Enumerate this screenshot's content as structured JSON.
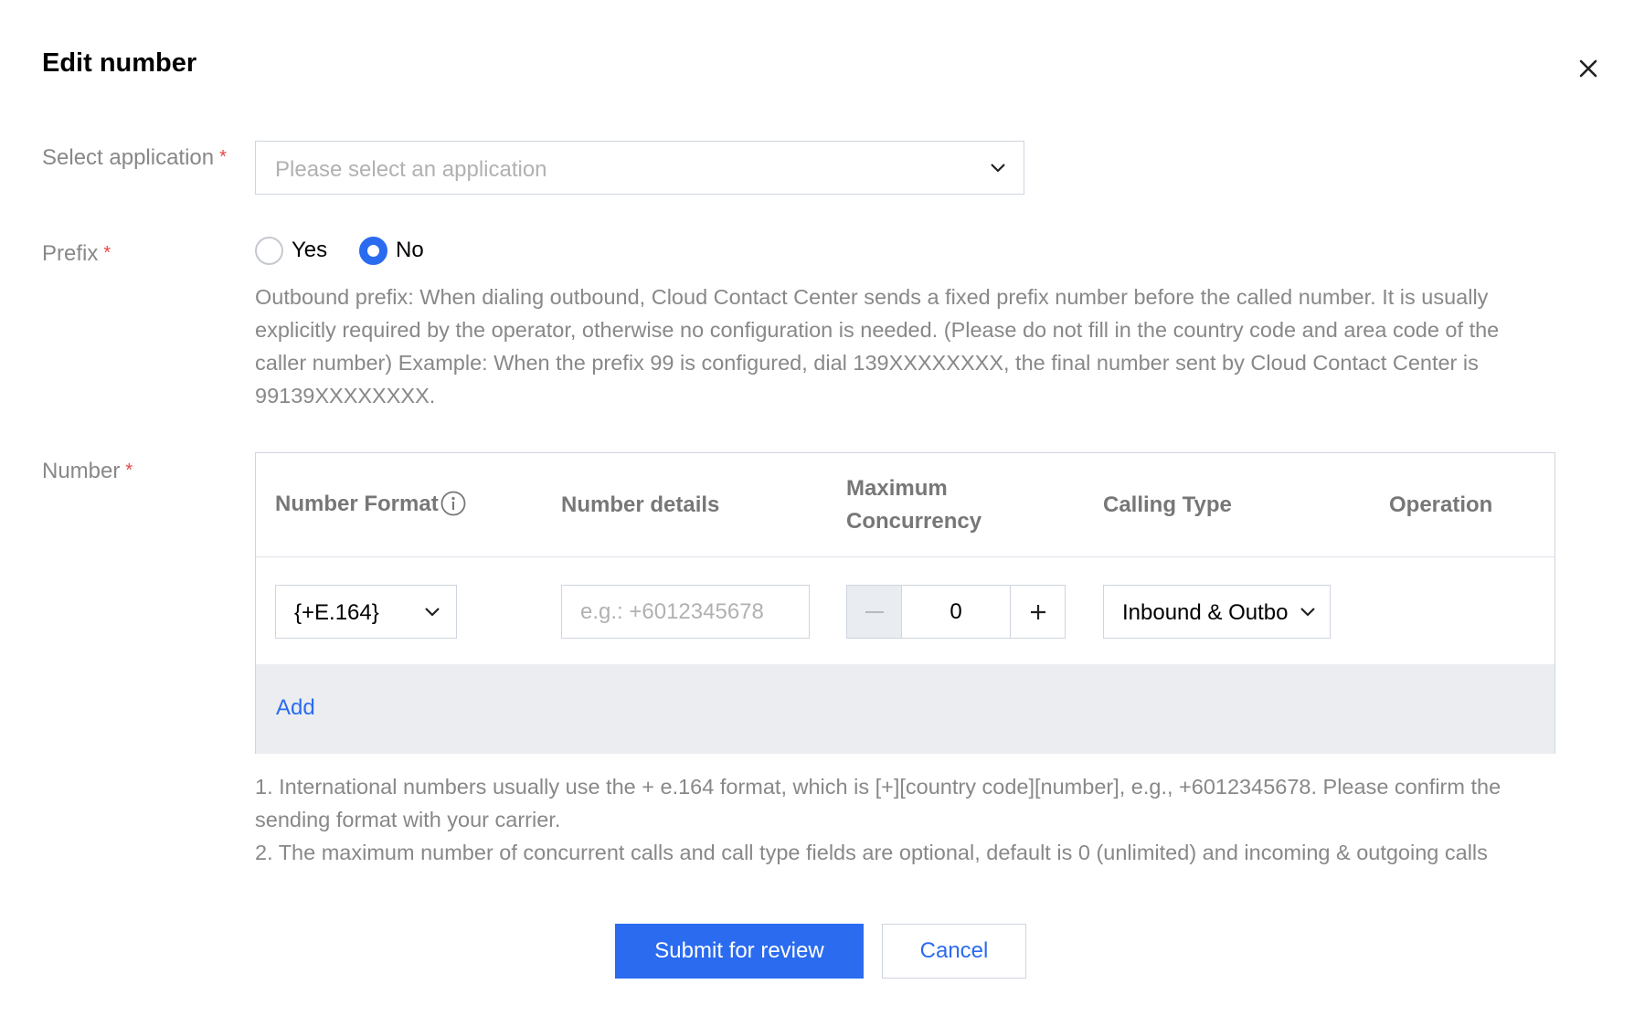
{
  "dialog": {
    "title": "Edit number",
    "close_icon": "close-icon"
  },
  "form": {
    "required_mark": "*",
    "application": {
      "label": "Select application",
      "placeholder": "Please select an application"
    },
    "prefix": {
      "label": "Prefix",
      "options": [
        {
          "label": "Yes",
          "selected": false
        },
        {
          "label": "No",
          "selected": true
        }
      ],
      "description": "Outbound prefix: When dialing outbound, Cloud Contact Center sends a fixed prefix number before the called number. It is usually explicitly required by the operator, otherwise no configuration is needed. (Please do not fill in the country code and area code of the caller number) Example: When the prefix 99 is configured, dial 139XXXXXXXX, the final number sent by Cloud Contact Center is 99139XXXXXXXX."
    },
    "number": {
      "label": "Number",
      "columns": {
        "format": "Number Format",
        "details": "Number details",
        "concurrency_line1": "Maximum",
        "concurrency_line2": "Concurrency",
        "calling_type": "Calling Type",
        "operation": "Operation"
      },
      "row": {
        "format_value": "{+E.164}",
        "details_placeholder": "e.g.: +6012345678",
        "concurrency_value": "0",
        "calling_type_value": "Inbound & Outbound"
      },
      "add_label": "Add",
      "notes": [
        "1. International numbers usually use the + e.164 format, which is [+][country code][number], e.g., +6012345678. Please confirm the sending format with your carrier.",
        "2. The maximum number of concurrent calls and call type fields are optional, default is 0 (unlimited) and incoming & outgoing calls"
      ]
    }
  },
  "actions": {
    "submit_label": "Submit for review",
    "cancel_label": "Cancel"
  },
  "colors": {
    "accent": "#2a6bf0",
    "required": "#e54545",
    "label": "#888888",
    "footer_bg": "#ebedf0"
  }
}
